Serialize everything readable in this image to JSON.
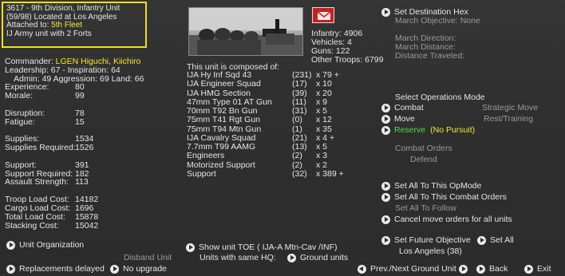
{
  "header": {
    "line1": "3617 - 9th Division, Infantry Unit",
    "line2": "(59/98) Located at  Los Angeles",
    "attached_label": "Attached to: ",
    "attached_value": "5th Fleet",
    "line4": "IJ Army unit with 2 Forts"
  },
  "commander": {
    "label": "Commander: ",
    "name": "LGEN Higuchi, Kiichiro",
    "leadership": "Leadership: 67 - Inspiration: 64",
    "skills": "Admin:  49  Aggression: 69 Land:  66"
  },
  "stats": [
    {
      "label": "Experience:",
      "value": "80"
    },
    {
      "label": "Morale:",
      "value": "99"
    },
    {
      "label": "Disruption:",
      "value": "78"
    },
    {
      "label": "Fatigue:",
      "value": "15"
    },
    {
      "label": "Supplies:",
      "value": "1534"
    },
    {
      "label": "Supplies Required:",
      "value": "1526"
    },
    {
      "label": "Support:",
      "value": "391"
    },
    {
      "label": "Support Required:",
      "value": "182"
    },
    {
      "label": "Assault Strength:",
      "value": "113"
    },
    {
      "label": "Troop Load Cost:",
      "value": "14182"
    },
    {
      "label": "Cargo Load Cost:",
      "value": "1696"
    },
    {
      "label": "Total Load Cost:",
      "value": "15878"
    },
    {
      "label": "Stacking Cost:",
      "value": "15042"
    }
  ],
  "icons": {
    "mail": "mail-icon",
    "photo": "unit-photo"
  },
  "colors": {
    "highlight": "#f2e830",
    "reserve": "#48e048",
    "mail": "#c82020"
  },
  "summary": {
    "infantry": "Infantry: 4906",
    "vehicles": "Vehicles: 4",
    "guns": "Guns: 122",
    "other": "Other Troops: 6799"
  },
  "toe_title": "This unit is composed of:",
  "toe": [
    {
      "name": "IJA Hy Inf Sqd 43",
      "count": "(231)",
      "qty": "x 79 +"
    },
    {
      "name": "IJA Engineer Squad",
      "count": "(17)",
      "qty": "x 10"
    },
    {
      "name": "IJA HMG Section",
      "count": "(39)",
      "qty": "x 20"
    },
    {
      "name": "47mm Type 01 AT Gun",
      "count": "(11)",
      "qty": "x 9"
    },
    {
      "name": "70mm T92 Bn Gun",
      "count": "(31)",
      "qty": "x 5"
    },
    {
      "name": "75mm T41 Rgt Gun",
      "count": "(0)",
      "qty": "x 12"
    },
    {
      "name": "75mm T94 Mtn Gun",
      "count": "(1)",
      "qty": "x 35"
    },
    {
      "name": "IJA Cavalry Squad",
      "count": "(21)",
      "qty": "x 4 +"
    },
    {
      "name": "7.7mm T99 AAMG",
      "count": "(13)",
      "qty": "x 5"
    },
    {
      "name": "Engineers",
      "count": "(2)",
      "qty": "x 3"
    },
    {
      "name": "Motorized Support",
      "count": "(2)",
      "qty": "x 2"
    },
    {
      "name": "Support",
      "count": "(32)",
      "qty": "x 389 +"
    }
  ],
  "right": {
    "set_destination": "Set Destination Hex",
    "march_objective": "March Objective: None",
    "march_direction": "March Direction:",
    "march_distance": "March Distance:",
    "distance_traveled": "Distance Traveled:",
    "select_ops": "Select Operations Mode",
    "combat": "Combat",
    "strategic_move": "Strategic Move",
    "move": "Move",
    "rest_training": "Rest/Training",
    "reserve": "Reserve",
    "no_pursuit": "(No Pursuit)",
    "combat_orders": "Combat Orders",
    "defend": "Defend",
    "set_all_opmode": "Set All To This OpMode",
    "set_all_combat": "Set All To This Combat Orders",
    "set_all_follow": "Set All To Follow",
    "cancel_move": "Cancel move orders for all units",
    "set_future": "Set Future Objective",
    "set_all": "Set All",
    "future_target": "Los Angeles (38)"
  },
  "bottom": {
    "unit_org": "Unit Organization",
    "disband": "Disband Unit",
    "replacements": "Replacements delayed",
    "no_upgrade": "No upgrade",
    "show_toe": "Show unit TOE ( IJA-A Mtn-Cav /INF)",
    "same_hq": "Units with same HQ:",
    "ground_units": "Ground units",
    "prev_next": "Prev./Next Ground Unit",
    "back": "Back",
    "exit": "Exit"
  }
}
